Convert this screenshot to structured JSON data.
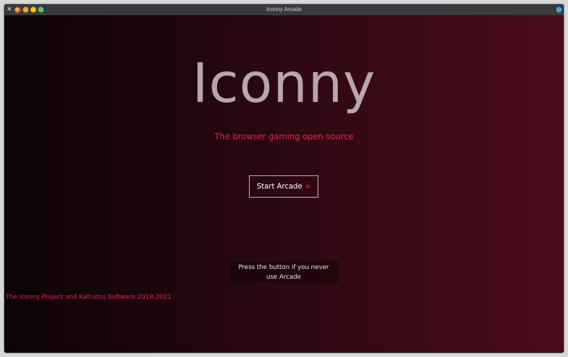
{
  "window": {
    "title": "Iconny Arcade"
  },
  "colors": {
    "accent": "#e8214f",
    "logo": "#b8a6ab",
    "close_dot": "#f5a623",
    "minimize_dot": "#f5c518",
    "maximize_dot": "#5cc84a",
    "status_dot": "#3fa3e0"
  },
  "icons": {
    "close": "close-icon",
    "app": "app-icon",
    "play": "play-icon"
  },
  "hero": {
    "logo_text": "Iconny",
    "tagline": "The browser gaming open source"
  },
  "actions": {
    "start_label": "Start Arcade"
  },
  "hint": {
    "line1": "Press the button if you never",
    "line2": "use Arcade"
  },
  "footer": {
    "credits": "The Iconny Project and Kalhatsu Software 2018-2021"
  }
}
